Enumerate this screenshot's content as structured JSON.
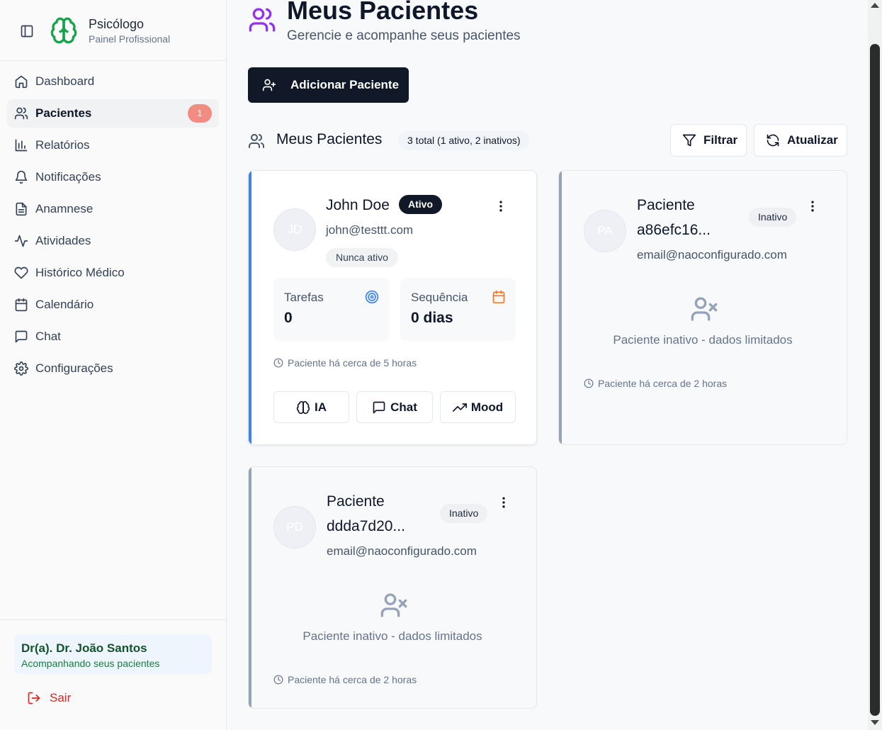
{
  "sidebar": {
    "app_title": "Psicólogo",
    "app_subtitle": "Painel Profissional",
    "items": [
      {
        "label": "Dashboard",
        "icon": "home-icon"
      },
      {
        "label": "Pacientes",
        "icon": "users-icon",
        "badge": "1",
        "active": true
      },
      {
        "label": "Relatórios",
        "icon": "bar-chart-icon"
      },
      {
        "label": "Notificações",
        "icon": "bell-icon"
      },
      {
        "label": "Anamnese",
        "icon": "file-text-icon"
      },
      {
        "label": "Atividades",
        "icon": "activity-icon"
      },
      {
        "label": "Histórico Médico",
        "icon": "heart-icon"
      },
      {
        "label": "Calendário",
        "icon": "calendar-icon"
      },
      {
        "label": "Chat",
        "icon": "message-square-icon"
      },
      {
        "label": "Configurações",
        "icon": "settings-icon"
      }
    ],
    "user_name": "Dr(a). Dr. João Santos",
    "user_subtitle": "Acompanhando seus pacientes",
    "logout_label": "Sair"
  },
  "header": {
    "title": "Meus Pacientes",
    "subtitle": "Gerencie e acompanhe seus pacientes",
    "add_button_label": "Adicionar Paciente"
  },
  "list": {
    "title": "Meus Pacientes",
    "total_badge": "3 total (1 ativo, 2 inativos)",
    "filter_label": "Filtrar",
    "refresh_label": "Atualizar"
  },
  "patients": [
    {
      "initials": "JD",
      "name": "John Doe",
      "status": "Ativo",
      "email": "john@testtt.com",
      "activity_badge": "Nunca ativo",
      "tasks_label": "Tarefas",
      "tasks_value": "0",
      "streak_label": "Sequência",
      "streak_value": "0 dias",
      "since": "Paciente há cerca de 5 horas",
      "actions": [
        "IA",
        "Chat",
        "Mood"
      ]
    },
    {
      "initials": "PA",
      "name_line1": "Paciente",
      "name_line2": "a86efc16...",
      "status": "Inativo",
      "email": "email@naoconfigurado.com",
      "inactive_message": "Paciente inativo - dados limitados",
      "since": "Paciente há cerca de 2 horas"
    },
    {
      "initials": "PD",
      "name_line1": "Paciente",
      "name_line2": "ddda7d20...",
      "status": "Inativo",
      "email": "email@naoconfigurado.com",
      "inactive_message": "Paciente inativo - dados limitados",
      "since": "Paciente há cerca de 2 horas"
    }
  ],
  "colors": {
    "brand_green": "#16a34a",
    "accent_purple": "#9333ea",
    "active_stripe": "#3b82f6",
    "inactive_stripe": "#94a3b8",
    "logout_red": "#dc2626",
    "badge_red": "#f28b82"
  }
}
